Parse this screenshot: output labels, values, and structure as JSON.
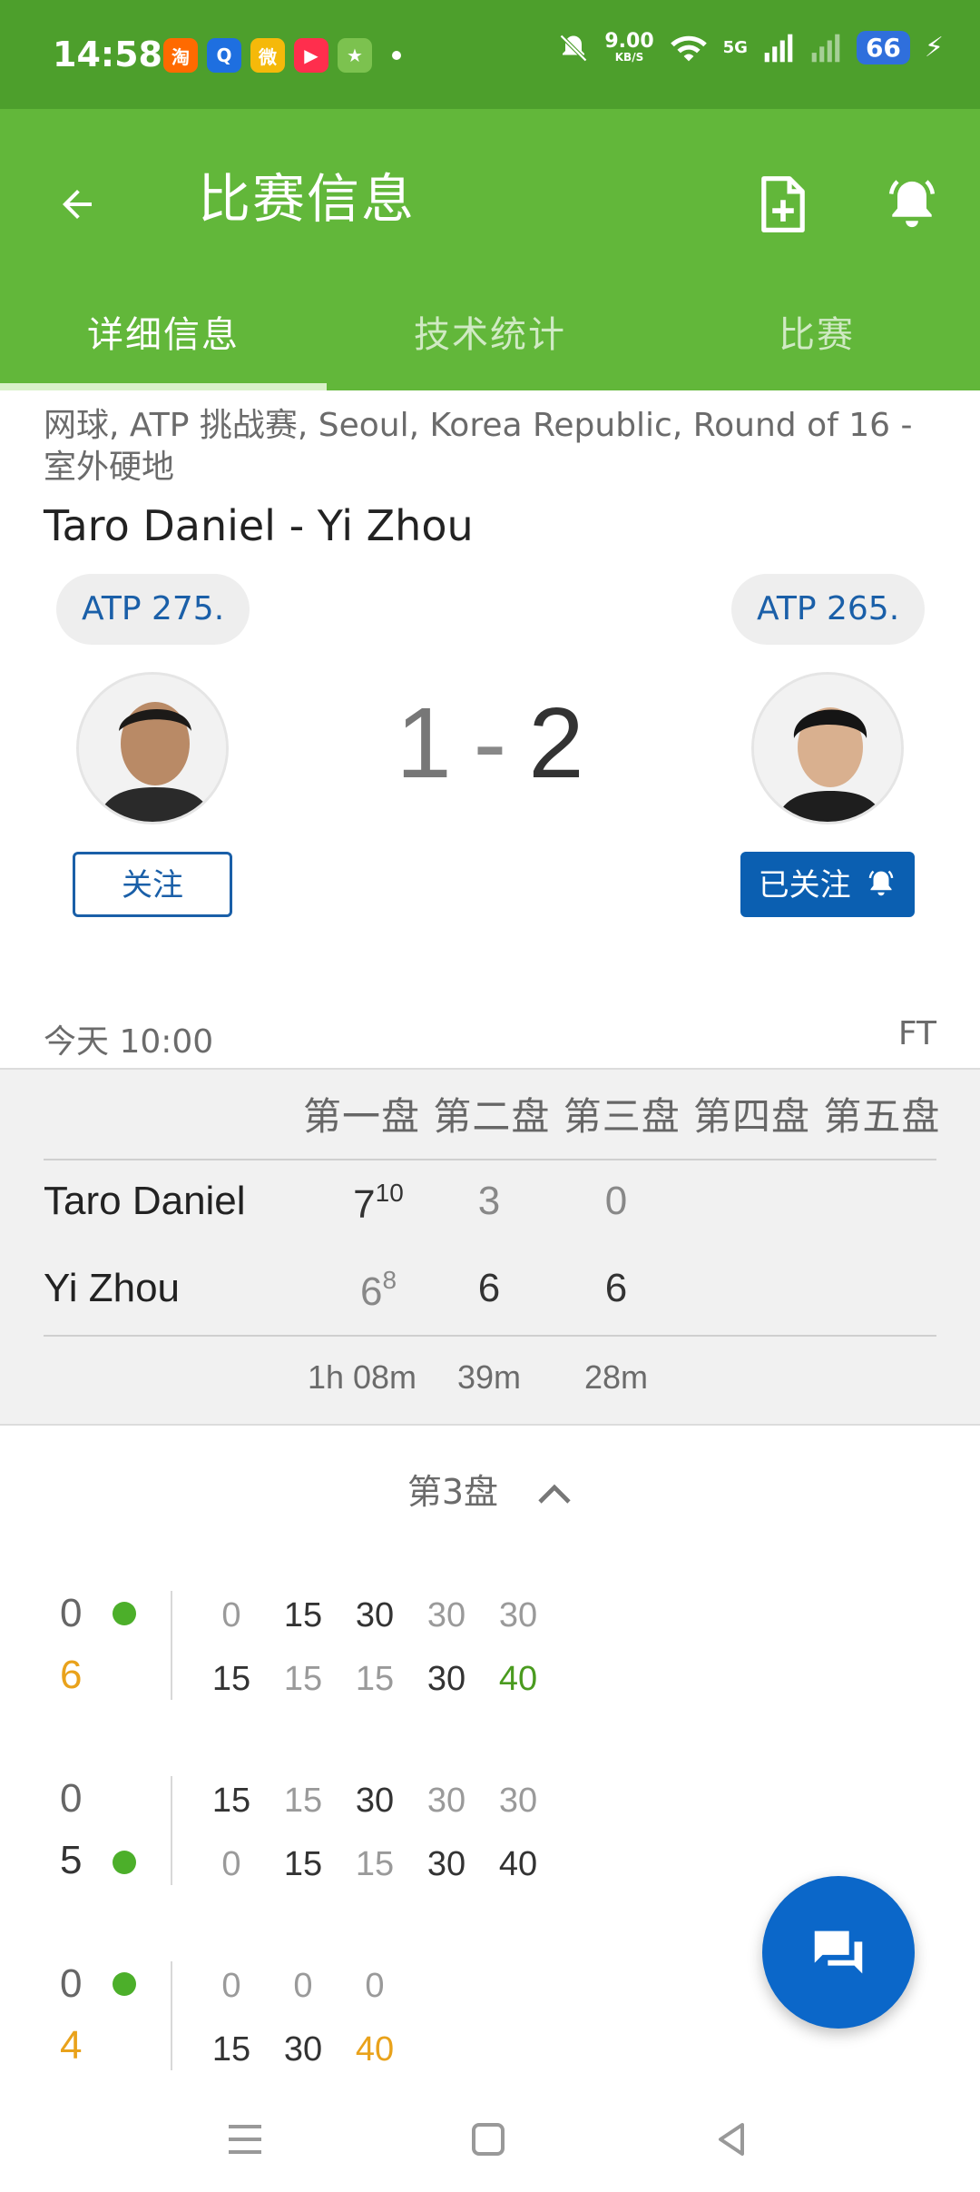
{
  "status_bar": {
    "time": "14:58",
    "app_icons": [
      {
        "name": "taobao-icon",
        "label": "淘",
        "color": "#ff6a00"
      },
      {
        "name": "app2-icon",
        "label": "Q",
        "color": "#1e6fe0"
      },
      {
        "name": "weibo-icon",
        "label": "微",
        "color": "#f5b90a"
      },
      {
        "name": "video-icon",
        "label": "▶",
        "color": "#ff2e4d"
      },
      {
        "name": "game-icon",
        "label": "★",
        "color": "#7cc24f"
      }
    ],
    "speed_value": "9.00",
    "speed_unit": "KB/S",
    "network": "5G",
    "battery": "66"
  },
  "app_bar": {
    "title": "比赛信息",
    "tabs": [
      {
        "label": "详细信息",
        "active": true
      },
      {
        "label": "技术统计",
        "active": false
      },
      {
        "label": "比赛",
        "active": false
      }
    ]
  },
  "match": {
    "subtitle": "网球, ATP 挑战赛, Seoul, Korea Republic, Round of 16 - 室外硬地",
    "name": "Taro Daniel - Yi Zhou",
    "player1": {
      "rank": "ATP 275.",
      "follow_label": "关注"
    },
    "player2": {
      "rank": "ATP 265.",
      "follow_label": "已关注"
    },
    "score_p1": "1",
    "score_sep": "-",
    "score_p2": "2",
    "start_time": "今天 10:00",
    "status": "FT"
  },
  "sets": {
    "header": "第一盘 第二盘 第三盘 第四盘 第五盘",
    "rows": [
      {
        "player": "Taro Daniel",
        "s1": "7",
        "s1_tb": "10",
        "s2": "3",
        "s3": "0"
      },
      {
        "player": "Yi Zhou",
        "s1": "6",
        "s1_tb": "8",
        "s2": "6",
        "s3": "6"
      }
    ],
    "durations": [
      "1h 08m",
      "39m",
      "28m"
    ]
  },
  "set_toggle_label": "第3盘",
  "games": [
    {
      "top_score": "0",
      "bottom_score": "6",
      "top_points": [
        "0",
        "15",
        "30",
        "30",
        "30"
      ],
      "bottom_points": [
        "15",
        "15",
        "15",
        "30",
        "40"
      ]
    },
    {
      "top_score": "0",
      "bottom_score": "5",
      "top_points": [
        "15",
        "15",
        "30",
        "30",
        "30"
      ],
      "bottom_points": [
        "0",
        "15",
        "15",
        "30",
        "40"
      ]
    },
    {
      "top_score": "0",
      "bottom_score": "4",
      "top_points": [
        "0",
        "0",
        "0"
      ],
      "bottom_points": [
        "15",
        "30",
        "40"
      ]
    }
  ],
  "colors": {
    "status_bar": "#4d9f2c",
    "app_bar": "#62b73a",
    "link_blue": "#1a5fa8",
    "follow_blue": "#0b5fb1",
    "fab_blue": "#0b67c9",
    "serve_green": "#4caf2a",
    "game_orange": "#e9a21b"
  }
}
